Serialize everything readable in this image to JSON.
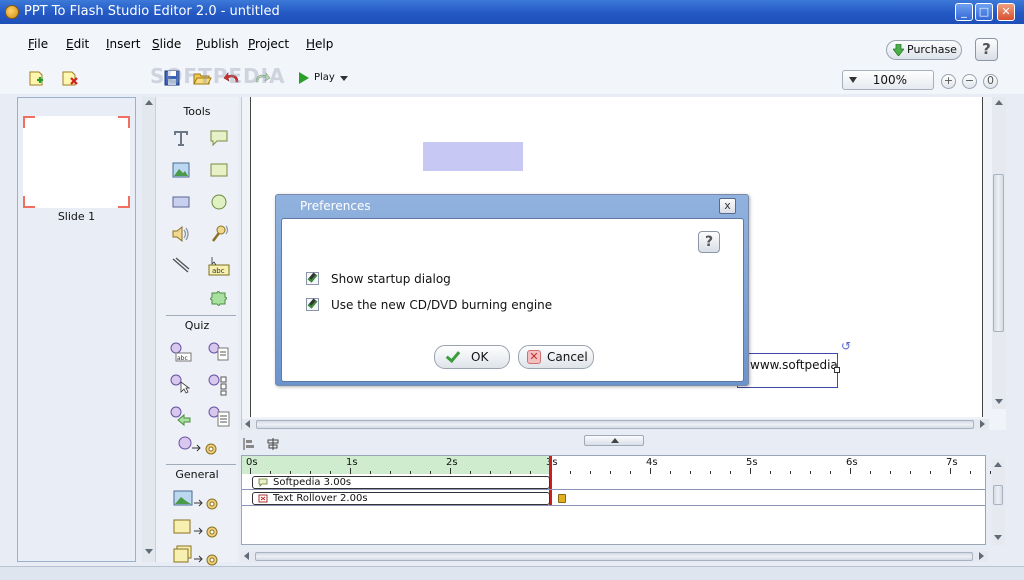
{
  "window": {
    "title": "PPT To Flash Studio Editor 2.0 - untitled"
  },
  "menu": [
    "File",
    "Edit",
    "Insert",
    "Slide",
    "Publish",
    "Project",
    "Help"
  ],
  "header": {
    "purchase_label": "Purchase",
    "help_glyph": "?"
  },
  "toolbar": {
    "play_label": "Play",
    "zoom": "100%",
    "zoom_in": "+",
    "zoom_out": "−",
    "zoom_reset": "0",
    "icons": [
      "new-slide-icon",
      "delete-slide-icon",
      "save-icon",
      "open-icon",
      "undo-icon",
      "redo-icon"
    ]
  },
  "watermark": "SOFTPEDIA",
  "slides": [
    {
      "label": "Slide 1"
    }
  ],
  "tools": {
    "sections": {
      "tools": "Tools",
      "quiz": "Quiz",
      "general": "General"
    }
  },
  "canvas": {
    "text_object": "www.softpedia.com"
  },
  "dialog": {
    "title": "Preferences",
    "close_glyph": "x",
    "help_glyph": "?",
    "options": [
      {
        "label": "Show startup dialog",
        "checked": true
      },
      {
        "label": "Use the new CD/DVD burning engine",
        "checked": true
      }
    ],
    "ok_label": "OK",
    "cancel_label": "Cancel"
  },
  "timeline": {
    "ticks": [
      "0s",
      "1s",
      "2s",
      "3s",
      "4s",
      "5s",
      "6s",
      "7s"
    ],
    "playhead_seconds": 3,
    "tracks": [
      {
        "label": "Softpedia  3.00s"
      },
      {
        "label": "Text Rollover  2.00s"
      }
    ]
  },
  "colors": {
    "titlebar": "#2458c4",
    "dialog_frame": "#6c94cc",
    "shape_fill": "#c8c8f4",
    "playhead": "#cc2020",
    "played": "#cfeccf"
  }
}
